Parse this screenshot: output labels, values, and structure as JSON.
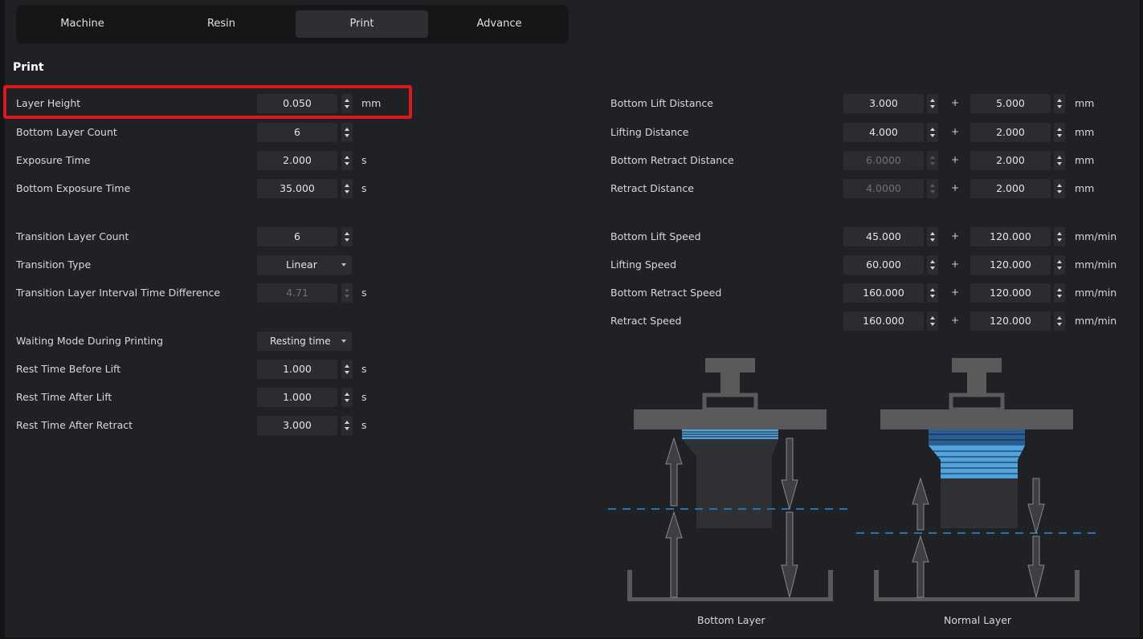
{
  "tabs": [
    {
      "label": "Machine"
    },
    {
      "label": "Resin"
    },
    {
      "label": "Print"
    },
    {
      "label": "Advance"
    }
  ],
  "active_tab": "Print",
  "section_title": "Print",
  "left_settings": [
    {
      "label": "Layer Height",
      "value": "0.050",
      "unit": "mm",
      "control": "spin",
      "highlighted": true
    },
    {
      "label": "Bottom Layer Count",
      "value": "6",
      "unit": "",
      "control": "spin"
    },
    {
      "label": "Exposure Time",
      "value": "2.000",
      "unit": "s",
      "control": "spin"
    },
    {
      "label": "Bottom Exposure Time",
      "value": "35.000",
      "unit": "s",
      "control": "spin"
    },
    {
      "label": "Transition Layer Count",
      "value": "6",
      "unit": "",
      "control": "spin"
    },
    {
      "label": "Transition Type",
      "value": "Linear",
      "unit": "",
      "control": "select"
    },
    {
      "label": "Transition Layer Interval Time Difference",
      "value": "4.71",
      "unit": "s",
      "control": "spin",
      "disabled": true
    },
    {
      "label": "Waiting Mode During Printing",
      "value": "Resting time",
      "unit": "",
      "control": "select"
    },
    {
      "label": "Rest Time Before Lift",
      "value": "1.000",
      "unit": "s",
      "control": "spin"
    },
    {
      "label": "Rest Time After Lift",
      "value": "1.000",
      "unit": "s",
      "control": "spin"
    },
    {
      "label": "Rest Time After Retract",
      "value": "3.000",
      "unit": "s",
      "control": "spin"
    }
  ],
  "right_settings": [
    {
      "label": "Bottom Lift Distance",
      "value1": "3.000",
      "value2": "5.000",
      "unit": "mm"
    },
    {
      "label": "Lifting Distance",
      "value1": "4.000",
      "value2": "2.000",
      "unit": "mm"
    },
    {
      "label": "Bottom Retract Distance",
      "value1": "6.0000",
      "value2": "2.000",
      "unit": "mm",
      "value1_disabled": true
    },
    {
      "label": "Retract Distance",
      "value1": "4.0000",
      "value2": "2.000",
      "unit": "mm",
      "value1_disabled": true
    },
    {
      "label": "Bottom Lift Speed",
      "value1": "45.000",
      "value2": "120.000",
      "unit": "mm/min"
    },
    {
      "label": "Lifting Speed",
      "value1": "60.000",
      "value2": "120.000",
      "unit": "mm/min"
    },
    {
      "label": "Bottom Retract Speed",
      "value1": "160.000",
      "value2": "120.000",
      "unit": "mm/min"
    },
    {
      "label": "Retract Speed",
      "value1": "160.000",
      "value2": "120.000",
      "unit": "mm/min"
    }
  ],
  "plus_sign": "+",
  "diagram": {
    "bottom_caption": "Bottom Layer",
    "normal_caption": "Normal Layer"
  },
  "colors": {
    "background": "#202124",
    "field": "#2b2c2f",
    "highlight": "#d9191c",
    "layer_blue": "#4fa3e0",
    "dashed_line": "#2f6fa8"
  }
}
